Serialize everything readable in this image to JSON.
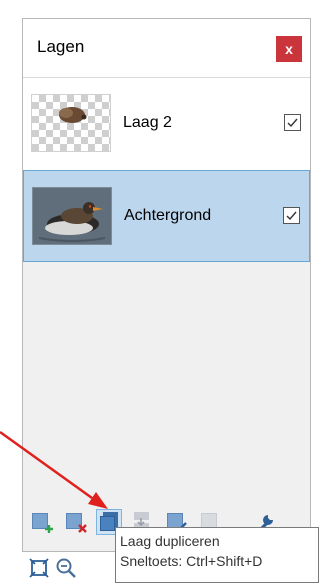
{
  "panel": {
    "title": "Lagen",
    "close_label": "x"
  },
  "layers": [
    {
      "name": "Laag 2",
      "visible": true,
      "selected": false
    },
    {
      "name": "Achtergrond",
      "visible": true,
      "selected": true
    }
  ],
  "toolbar": {
    "buttons": [
      {
        "icon": "add-layer-icon"
      },
      {
        "icon": "delete-layer-icon"
      },
      {
        "icon": "duplicate-layer-icon"
      },
      {
        "icon": "merge-layer-icon"
      },
      {
        "icon": "move-layer-up-icon"
      },
      {
        "icon": "move-layer-down-icon"
      },
      {
        "icon": "layer-properties-icon"
      }
    ]
  },
  "tooltip": {
    "line1": "Laag dupliceren",
    "line2": "Sneltoets: Ctrl+Shift+D"
  },
  "colors": {
    "accent": "#c9353b",
    "selection": "#bcd6ee",
    "arrow": "#e0201c"
  }
}
